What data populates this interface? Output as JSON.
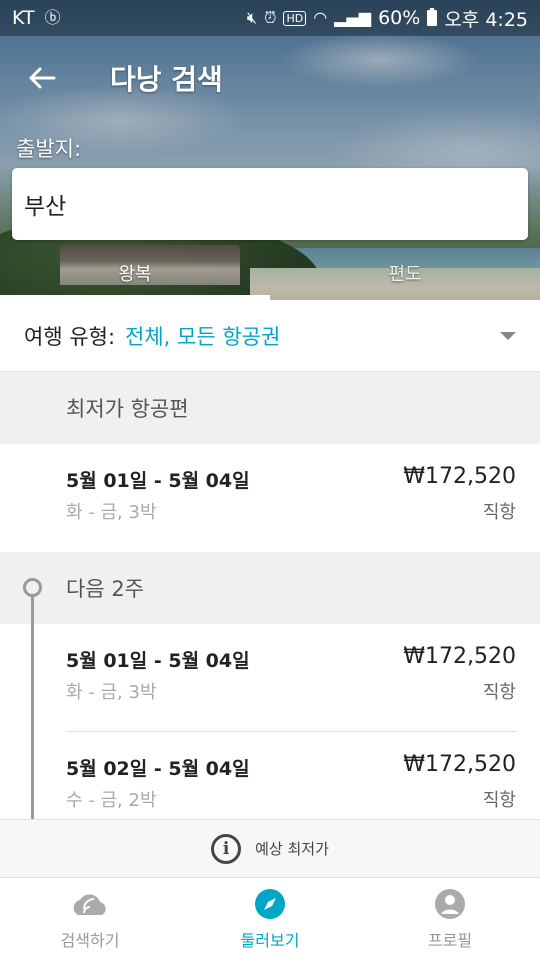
{
  "status_bar": {
    "carrier": "KT",
    "battery": "60%",
    "time": "오후 4:25"
  },
  "header": {
    "title": "다낭 검색"
  },
  "origin": {
    "label": "출발지:",
    "value": "부산"
  },
  "trip_tabs": [
    {
      "label": "왕복",
      "active": true
    },
    {
      "label": "편도",
      "active": false
    }
  ],
  "trip_type": {
    "label": "여행 유형:",
    "value": "전체, 모든 항공권"
  },
  "sections": {
    "cheapest": {
      "header": "최저가 항공편",
      "items": [
        {
          "dates": "5월 01일 - 5월 04일",
          "sub": "화 - 금, 3박",
          "price": "₩172,520",
          "type": "직항"
        }
      ]
    },
    "next_two_weeks": {
      "header": "다음 2주",
      "items": [
        {
          "dates": "5월 01일 - 5월 04일",
          "sub": "화 - 금, 3박",
          "price": "₩172,520",
          "type": "직항"
        },
        {
          "dates": "5월 02일 - 5월 04일",
          "sub": "수 - 금, 2박",
          "price": "₩172,520",
          "type": "직항"
        }
      ]
    }
  },
  "estimate_banner": {
    "text": "예상 최저가"
  },
  "bottom_nav": [
    {
      "label": "검색하기",
      "icon": "cloud-signal-icon",
      "active": false
    },
    {
      "label": "둘러보기",
      "icon": "compass-icon",
      "active": true
    },
    {
      "label": "프로필",
      "icon": "person-icon",
      "active": false
    }
  ],
  "colors": {
    "accent": "#00a6c8",
    "inactive": "#999999"
  }
}
